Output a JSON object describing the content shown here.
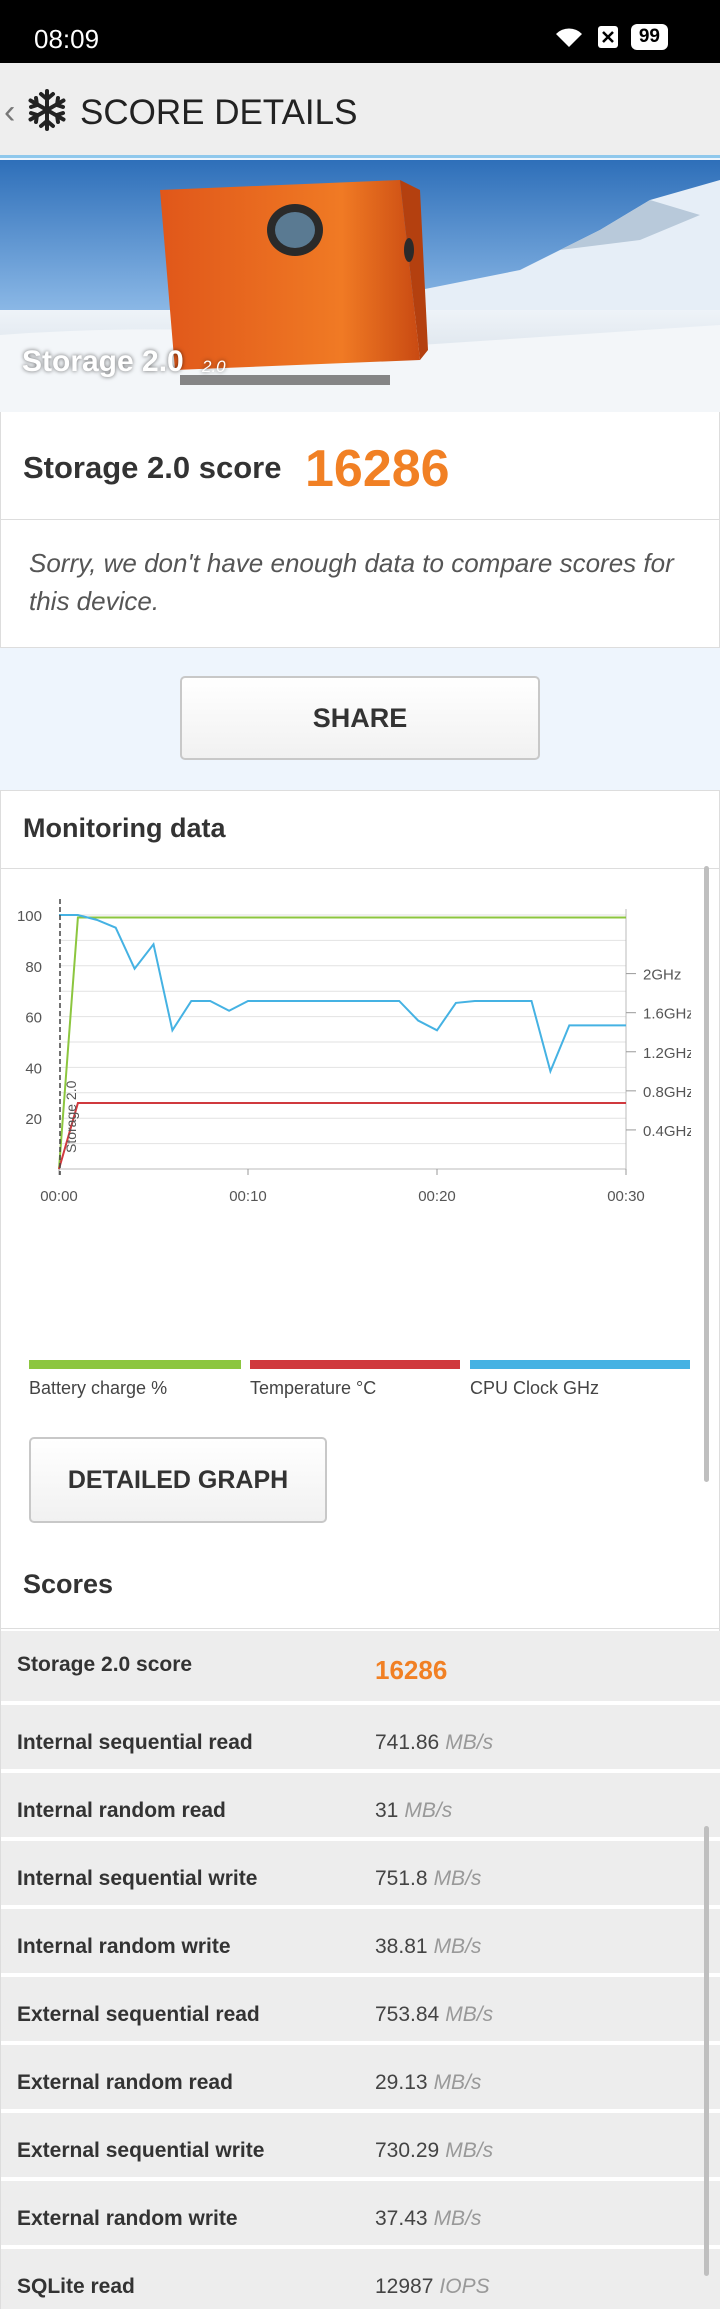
{
  "status_bar": {
    "time": "08:09",
    "battery": "99"
  },
  "app_bar": {
    "title": "SCORE DETAILS"
  },
  "hero": {
    "title": "Storage 2.0",
    "version": "2.0"
  },
  "score": {
    "label": "Storage 2.0 score",
    "value": "16286"
  },
  "compare": {
    "message": "Sorry, we don't have enough data to compare scores for this device."
  },
  "share": {
    "label": "SHARE"
  },
  "monitoring": {
    "title": "Monitoring data",
    "detailed_button": "DETAILED GRAPH",
    "legend": [
      {
        "label": "Battery charge %",
        "color": "#8cc63f"
      },
      {
        "label": "Temperature °C",
        "color": "#d0393e"
      },
      {
        "label": "CPU Clock GHz",
        "color": "#45b2e3"
      }
    ]
  },
  "chart_data": {
    "type": "line",
    "x_ticks": [
      "00:00",
      "00:10",
      "00:20",
      "00:30"
    ],
    "y_left_ticks": [
      "100",
      "80",
      "60",
      "40",
      "20"
    ],
    "y_right_ticks": [
      "2GHz",
      "1.6GHz",
      "1.2GHz",
      "0.8GHz",
      "0.4GHz"
    ],
    "marker_label": "Storage 2.0",
    "ylim": [
      0,
      100
    ],
    "y_right_lim": [
      0,
      2.6
    ],
    "series": [
      {
        "name": "Battery charge %",
        "color": "#8cc63f",
        "axis": "left",
        "x": [
          "00:00",
          "00:01",
          "00:30"
        ],
        "y": [
          0,
          99,
          99
        ]
      },
      {
        "name": "Temperature °C",
        "color": "#d0393e",
        "axis": "left",
        "x": [
          "00:00",
          "00:01",
          "00:30"
        ],
        "y": [
          0,
          26,
          26
        ]
      },
      {
        "name": "CPU Clock GHz",
        "color": "#45b2e3",
        "axis": "right",
        "x": [
          "00:00",
          "00:01",
          "00:02",
          "00:03",
          "00:04",
          "00:05",
          "00:06",
          "00:07",
          "00:08",
          "00:09",
          "00:10",
          "00:11",
          "00:12",
          "00:14",
          "00:16",
          "00:18",
          "00:19",
          "00:20",
          "00:21",
          "00:22",
          "00:24",
          "00:25",
          "00:26",
          "00:27",
          "00:28",
          "00:30"
        ],
        "y": [
          2.6,
          2.6,
          2.55,
          2.47,
          2.05,
          2.3,
          1.42,
          1.72,
          1.72,
          1.62,
          1.72,
          1.72,
          1.72,
          1.72,
          1.72,
          1.72,
          1.52,
          1.42,
          1.7,
          1.72,
          1.72,
          1.72,
          1.0,
          1.47,
          1.47,
          1.47
        ]
      }
    ]
  },
  "scores": {
    "title": "Scores",
    "rows": [
      {
        "name": "Storage 2.0 score",
        "value": "16286",
        "unit": ""
      },
      {
        "name": "Internal sequential read",
        "value": "741.86",
        "unit": "MB/s"
      },
      {
        "name": "Internal random read",
        "value": "31",
        "unit": "MB/s"
      },
      {
        "name": "Internal sequential write",
        "value": "751.8",
        "unit": "MB/s"
      },
      {
        "name": "Internal random write",
        "value": "38.81",
        "unit": "MB/s"
      },
      {
        "name": "External sequential read",
        "value": "753.84",
        "unit": "MB/s"
      },
      {
        "name": "External random read",
        "value": "29.13",
        "unit": "MB/s"
      },
      {
        "name": "External sequential write",
        "value": "730.29",
        "unit": "MB/s"
      },
      {
        "name": "External random write",
        "value": "37.43",
        "unit": "MB/s"
      },
      {
        "name": "SQLite read",
        "value": "12987",
        "unit": "IOPS"
      }
    ]
  }
}
